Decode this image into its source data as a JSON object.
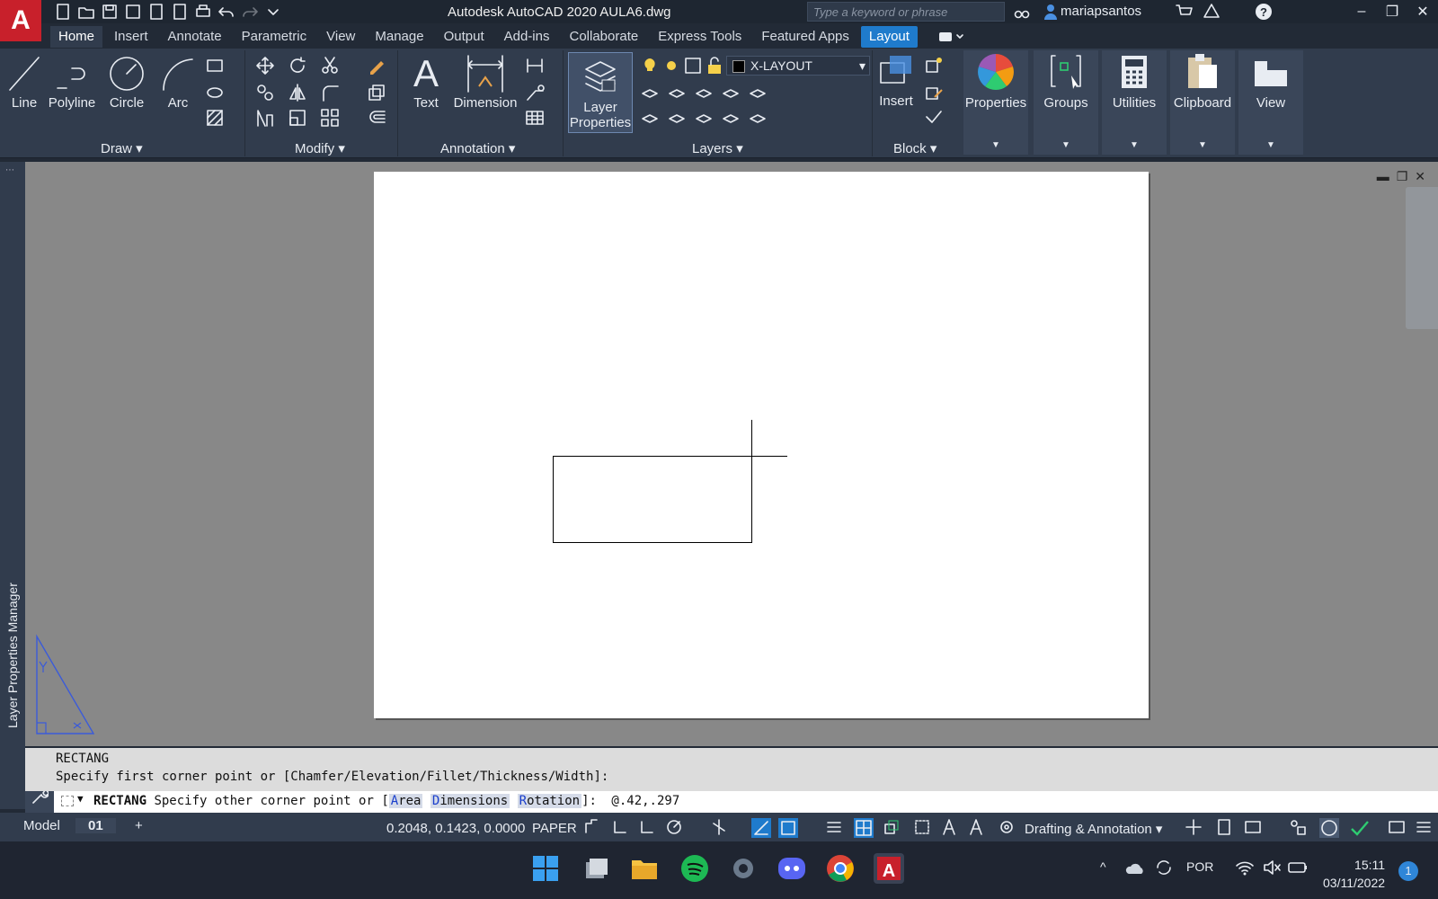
{
  "app": {
    "logo_letter": "A",
    "title": "Autodesk AutoCAD 2020    AULA6.dwg",
    "search_placeholder": "Type a keyword or phrase",
    "user": "mariapsantos"
  },
  "tabs": [
    "Home",
    "Insert",
    "Annotate",
    "Parametric",
    "View",
    "Manage",
    "Output",
    "Add-ins",
    "Collaborate",
    "Express Tools",
    "Featured Apps",
    "Layout"
  ],
  "ribbon": {
    "draw": {
      "line": "Line",
      "polyline": "Polyline",
      "circle": "Circle",
      "arc": "Arc",
      "panel": "Draw"
    },
    "modify": {
      "panel": "Modify"
    },
    "annotation": {
      "text": "Text",
      "dimension": "Dimension",
      "panel": "Annotation"
    },
    "layers": {
      "layer_properties_1": "Layer",
      "layer_properties_2": "Properties",
      "current_layer": "X-LAYOUT",
      "panel": "Layers"
    },
    "block": {
      "insert": "Insert",
      "panel": "Block"
    },
    "properties": "Properties",
    "groups": "Groups",
    "utilities": "Utilities",
    "clipboard": "Clipboard",
    "view": "View"
  },
  "side_palette": "Layer Properties Manager",
  "command": {
    "history1": "RECTANG",
    "history2": "Specify first corner point or [Chamfer/Elevation/Fillet/Thickness/Width]:",
    "prompt_cmd": "RECTANG",
    "prompt_text": "Specify other corner point or [",
    "opt_area_k": "A",
    "opt_area_r": "rea",
    "opt_dim_k": "D",
    "opt_dim_r": "imensions",
    "opt_rot_k": "R",
    "opt_rot_r": "otation",
    "prompt_end": "]:",
    "input": "@.42,.297"
  },
  "status": {
    "model": "Model",
    "layout": "01",
    "add": "+",
    "coords": "0.2048, 0.1423, 0.0000",
    "space": "PAPER",
    "workspace": "Drafting & Annotation"
  },
  "taskbar": {
    "lang": "POR",
    "time": "15:11",
    "date": "03/11/2022",
    "notif": "1"
  },
  "colors": {
    "accent": "#1f7bcc",
    "logo": "#c8202b",
    "ucs": "#3b5bd9"
  }
}
